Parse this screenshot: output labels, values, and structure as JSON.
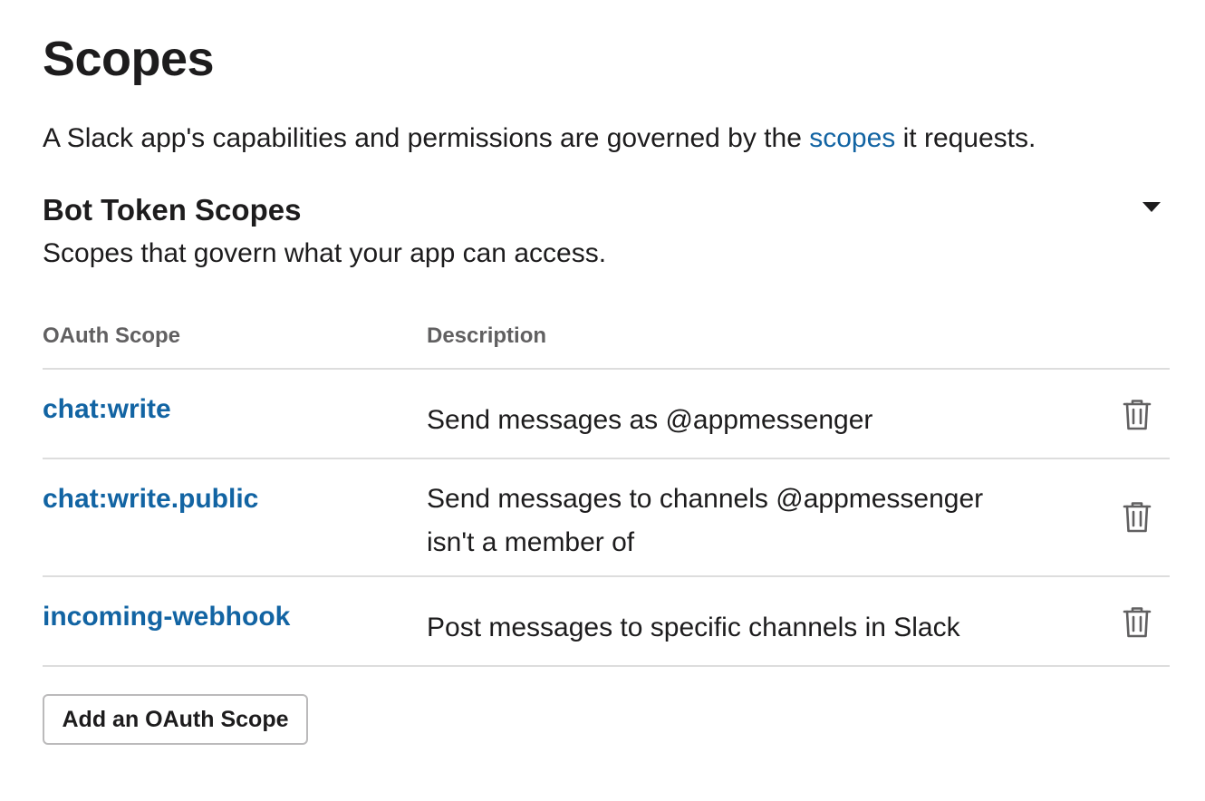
{
  "page": {
    "title": "Scopes",
    "intro_before": "A Slack app's capabilities and permissions are governed by the ",
    "intro_link": "scopes",
    "intro_after": " it requests."
  },
  "bot_token_section": {
    "title": "Bot Token Scopes",
    "subtitle": "Scopes that govern what your app can access.",
    "toggle_icon": "caret-down-icon",
    "columns": {
      "scope": "OAuth Scope",
      "description": "Description"
    },
    "rows": [
      {
        "scope": "chat:write",
        "description": "Send messages as @appmessenger",
        "action_icon": "trash-icon"
      },
      {
        "scope": "chat:write.public",
        "description": "Send messages to channels @appmessenger isn't a member of",
        "action_icon": "trash-icon"
      },
      {
        "scope": "incoming-webhook",
        "description": "Post messages to specific channels in Slack",
        "action_icon": "trash-icon"
      }
    ],
    "add_button_label": "Add an OAuth Scope"
  },
  "colors": {
    "link": "#1264a3",
    "text": "#1d1c1d",
    "muted": "#616061",
    "divider": "#dddddd",
    "button_border": "#bbbabb"
  }
}
